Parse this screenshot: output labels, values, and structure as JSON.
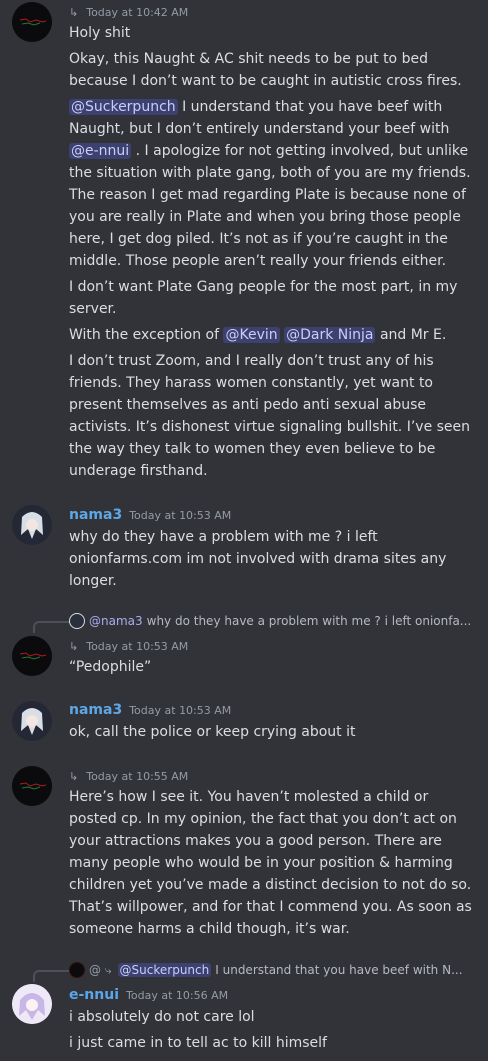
{
  "messages": {
    "m1": {
      "timestamp": "Today at 10:42 AM",
      "lines": {
        "l1": "Holy shit",
        "l2a": "Okay, this Naught & AC shit needs to be put to bed",
        "l2b": "because I don’t want to be caught in autistic cross fires.",
        "l3_mention": "@Suckerpunch",
        "l3_text": "I understand that you have beef with",
        "l4": "Naught, but I don’t entirely understand your beef with",
        "l5_mention": "@e-nnui",
        "l5_text": ". I apologize for not getting involved, but unlike",
        "l6": "the situation with plate gang, both of you are my friends.",
        "l7": "The reason I get mad regarding Plate is because none of",
        "l8": "you are really in Plate and when you bring those people",
        "l9": "here, I get dog piled. It’s not as if you’re caught in the",
        "l10": "middle. Those people aren’t really your friends either.",
        "l11a": "I don’t want Plate Gang people for the most part, in my",
        "l11b": "server.",
        "l12_prefix": "With the exception of",
        "l12_mention1": "@Kevin",
        "l12_mention2": "@Dark Ninja",
        "l12_suffix": "and Mr E.",
        "l13": "I don’t trust Zoom, and I really don’t trust any of his",
        "l14": "friends. They harass women constantly, yet want to",
        "l15": "present themselves as anti pedo anti sexual abuse",
        "l16": "activists. It’s dishonest virtue signaling bullshit. I’ve seen",
        "l17": "the way they talk to women they even believe to be",
        "l18": "underage firsthand."
      }
    },
    "m2": {
      "author": "nama3",
      "timestamp": "Today at 10:53 AM",
      "l1": "why do they have a problem with me ? i left",
      "l2": "onionfarms.com im not involved with drama sites any",
      "l3": "longer."
    },
    "m3": {
      "reply_to_name": "@nama3",
      "reply_to_text": "why do they have a problem with me ? i left onionfa...",
      "timestamp": "Today at 10:53 AM",
      "l1": "“Pedophile”"
    },
    "m4": {
      "author": "nama3",
      "timestamp": "Today at 10:53 AM",
      "l1": "ok, call the police or keep crying about it"
    },
    "m5": {
      "timestamp": "Today at 10:55 AM",
      "l1": "Here’s how I see it. You haven’t molested a child or",
      "l2": "posted cp. In my opinion, the fact that you don’t act on",
      "l3": "your attractions makes you a good person. There are",
      "l4": "many people who would be in your position & harming",
      "l5": "children yet you’ve made a distinct decision to not do so.",
      "l6": "That’s willpower, and for that I commend you. As soon as",
      "l7": "someone harms a child though, it’s war."
    },
    "m6": {
      "reply_prefix": "@ ⤷",
      "reply_to_mention": "@Suckerpunch",
      "reply_to_text": "I understand that you have beef with N...",
      "author": "e-nnui",
      "timestamp": "Today at 10:56 AM",
      "l1": "i absolutely do not care lol",
      "l2": "i just came in to tell ac to kill himself"
    }
  },
  "icons": {
    "subreply": "⤷",
    "reply_subreply": "↳"
  },
  "colors": {
    "background": "#313338",
    "name": "#5ea7e6",
    "mention_bg": "#3c4270",
    "text": "#dbdee1",
    "muted": "#949ba4"
  }
}
